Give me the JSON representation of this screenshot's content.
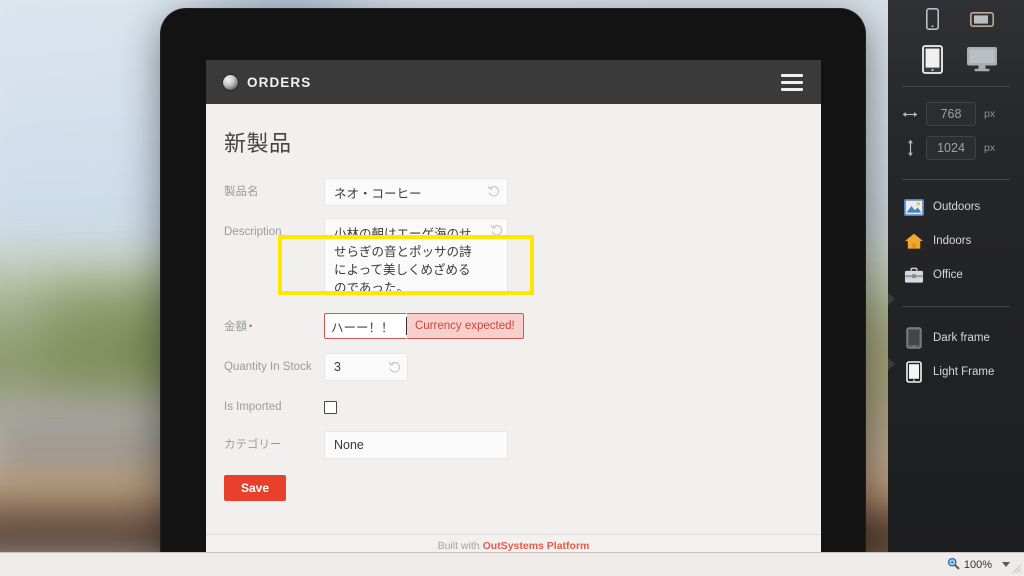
{
  "backdrop": {
    "note": "blurred outdoor photo"
  },
  "device": {
    "kind": "tablet-frame",
    "app": {
      "header": {
        "logo_icon": "orb-logo-icon",
        "title": "ORDERS",
        "menu_icon": "hamburger-menu-icon"
      },
      "page_title": "新製品",
      "form": {
        "fields": [
          {
            "key": "product_name",
            "label": "製品名",
            "required": false,
            "type": "text",
            "value": "ネオ・コーヒー",
            "undo_icon": "undo-icon"
          },
          {
            "key": "description",
            "label": "Description",
            "required": false,
            "type": "textarea",
            "value": "小林の朝はエーゲ海のせせらぎの音とポッサの詩によって美しくめざめるのであった。",
            "undo_icon": "undo-icon"
          },
          {
            "key": "amount",
            "label": "金額",
            "required": true,
            "required_marker": "•",
            "type": "currency",
            "value": "ハーー！！",
            "error": "Currency expected!",
            "highlighted": true
          },
          {
            "key": "quantity_in_stock",
            "label": "Quantity In Stock",
            "required": false,
            "type": "number",
            "value": "3",
            "undo_icon": "undo-icon"
          },
          {
            "key": "is_imported",
            "label": "Is Imported",
            "required": false,
            "type": "checkbox",
            "value": "",
            "checked": false
          },
          {
            "key": "category",
            "label": "カテゴリー",
            "required": false,
            "type": "select",
            "value": "None"
          }
        ],
        "save_label": "Save"
      },
      "footer": {
        "prefix": "Built with",
        "brand": "OutSystems Platform"
      }
    }
  },
  "panel": {
    "devices": [
      {
        "name": "phone-portrait",
        "icon": "phone-portrait-icon",
        "selected": false
      },
      {
        "name": "phone-landscape",
        "icon": "phone-landscape-icon",
        "selected": false
      },
      {
        "name": "tablet-portrait",
        "icon": "tablet-portrait-icon",
        "selected": true
      },
      {
        "name": "desktop",
        "icon": "desktop-monitor-icon",
        "selected": false
      }
    ],
    "dimensions": {
      "width": {
        "icon": "width-arrow-icon",
        "value": "768",
        "unit": "px"
      },
      "height": {
        "icon": "height-arrow-icon",
        "value": "1024",
        "unit": "px"
      }
    },
    "scenes": [
      {
        "label": "Outdoors",
        "icon": "landscape-image-icon"
      },
      {
        "label": "Indoors",
        "icon": "house-icon"
      },
      {
        "label": "Office",
        "icon": "briefcase-icon"
      }
    ],
    "frames": [
      {
        "label": "Dark frame",
        "icon": "dark-tablet-frame-icon"
      },
      {
        "label": "Light Frame",
        "icon": "light-tablet-frame-icon"
      }
    ]
  },
  "statusbar": {
    "zoom": {
      "icon": "magnifier-icon",
      "value": "100%",
      "caret_icon": "chevron-down-icon"
    }
  },
  "colors": {
    "accent_red": "#e8402b",
    "error_red": "#d9534f",
    "highlight_yellow": "#ffe800",
    "header_dark": "#3a3a3a",
    "panel_dark": "#26282a"
  }
}
